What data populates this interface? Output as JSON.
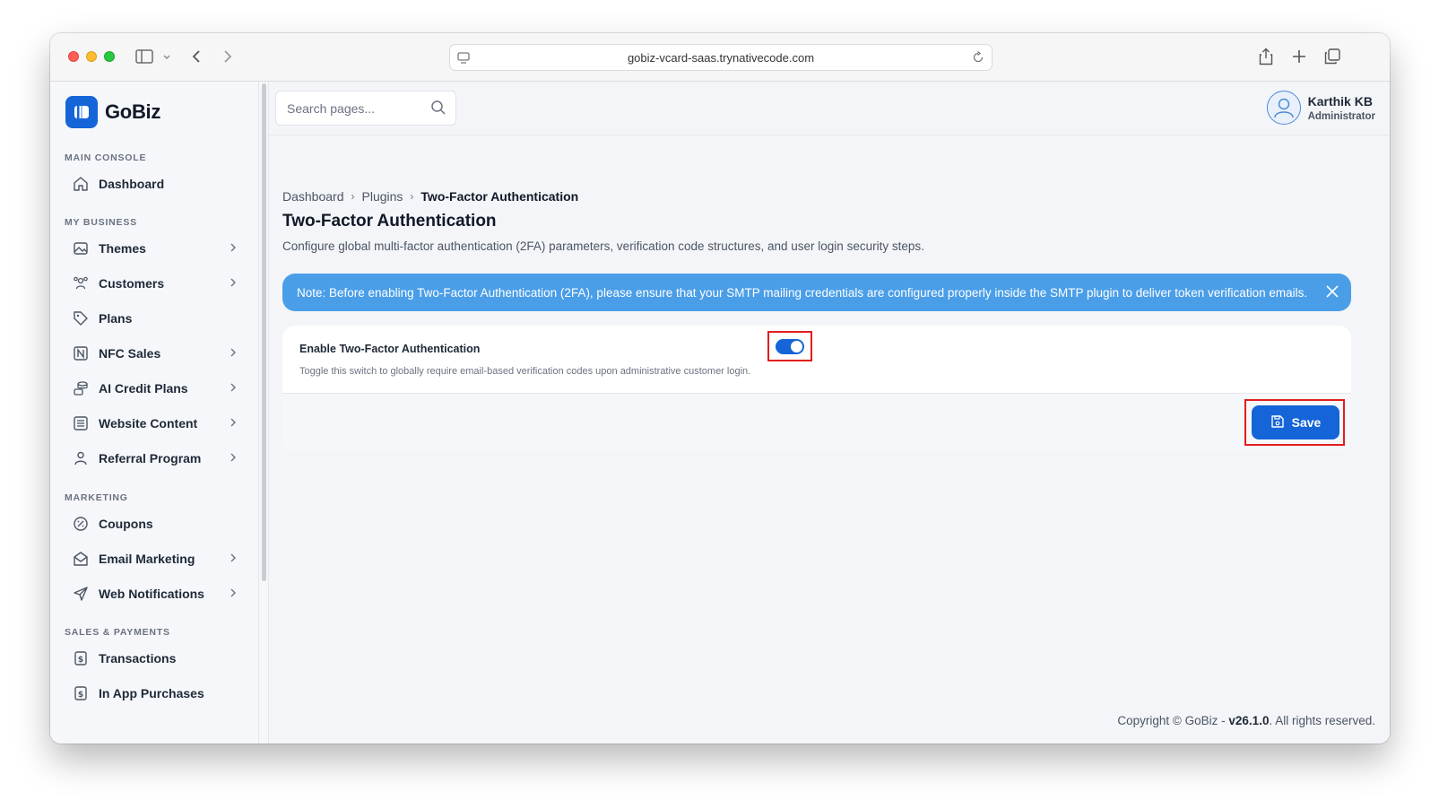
{
  "browser": {
    "url": "gobiz-vcard-saas.trynativecode.com"
  },
  "brand": {
    "name": "GoBiz",
    "color": "#1565d8"
  },
  "sidebar": {
    "sections": {
      "main_console": "MAIN CONSOLE",
      "my_business": "MY BUSINESS",
      "marketing": "MARKETING",
      "sales_payments": "SALES & PAYMENTS"
    },
    "items": [
      {
        "label": "Dashboard",
        "icon": "home-icon"
      },
      {
        "label": "Themes",
        "icon": "image-icon"
      },
      {
        "label": "Customers",
        "icon": "users-icon"
      },
      {
        "label": "Plans",
        "icon": "tag-icon"
      },
      {
        "label": "NFC Sales",
        "icon": "nfc-icon"
      },
      {
        "label": "AI Credit Plans",
        "icon": "coins-icon"
      },
      {
        "label": "Website Content",
        "icon": "document-icon"
      },
      {
        "label": "Referral Program",
        "icon": "user-icon"
      },
      {
        "label": "Coupons",
        "icon": "discount-icon"
      },
      {
        "label": "Email Marketing",
        "icon": "mail-icon"
      },
      {
        "label": "Web Notifications",
        "icon": "send-icon"
      },
      {
        "label": "Transactions",
        "icon": "receipt-icon"
      },
      {
        "label": "In App Purchases",
        "icon": "receipt-icon"
      }
    ]
  },
  "topbar": {
    "search_placeholder": "Search pages...",
    "user_name": "Karthik KB",
    "user_role": "Administrator"
  },
  "breadcrumb": {
    "items": [
      "Dashboard",
      "Plugins",
      "Two-Factor Authentication"
    ]
  },
  "page": {
    "title": "Two-Factor Authentication",
    "description": "Configure global multi-factor authentication (2FA) parameters, verification code structures, and user login security steps.",
    "note": "Note: Before enabling Two-Factor Authentication (2FA), please ensure that your SMTP mailing credentials are configured properly inside the SMTP plugin to deliver token verification emails.",
    "toggle_label": "Enable Two-Factor Authentication",
    "toggle_help": "Toggle this switch to globally require email-based verification codes upon administrative customer login.",
    "toggle_on": true,
    "save_label": "Save"
  },
  "footer": {
    "prefix": "Copyright © GoBiz - ",
    "version": "v26.1.0",
    "suffix": ". All rights reserved."
  }
}
